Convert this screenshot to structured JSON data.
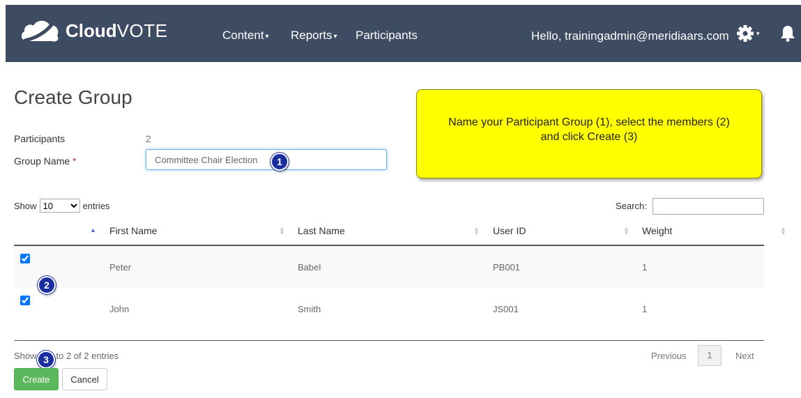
{
  "header": {
    "brand_bold": "Cloud",
    "brand_light": "VOTE",
    "nav": [
      {
        "label": "Content",
        "has_caret": true
      },
      {
        "label": "Reports",
        "has_caret": true
      },
      {
        "label": "Participants",
        "has_caret": false
      }
    ],
    "greeting": "Hello, trainingadmin@meridiaars.com",
    "icons": [
      "cloud-logo-icon",
      "gear-icon",
      "bell-icon"
    ],
    "bg_color": "#3d4b63"
  },
  "page": {
    "title": "Create Group",
    "participants_label": "Participants",
    "participants_count": "2",
    "group_name_label": "Group Name",
    "required_mark": "*",
    "group_name_value": "Committee Chair Election"
  },
  "callout": {
    "line1": "Name your Participant Group (1), select the members (2)",
    "line2": "and click Create (3)",
    "color": "#ffff00"
  },
  "badges": {
    "one": "1",
    "two": "2",
    "three": "3"
  },
  "table_controls": {
    "show_label": "Show",
    "entries_value": "10",
    "entries_label": "entries",
    "search_label": "Search:"
  },
  "table": {
    "columns": [
      "First Name",
      "Last Name",
      "User ID",
      "Weight"
    ],
    "rows": [
      {
        "checked": true,
        "first": "Peter",
        "last": "Babel",
        "user_id": "PB001",
        "weight": "1"
      },
      {
        "checked": true,
        "first": "John",
        "last": "Smith",
        "user_id": "JS001",
        "weight": "1"
      }
    ]
  },
  "footer": {
    "info_prefix": "Show",
    "info_suffix": "to 2 of 2 entries",
    "prev_label": "Previous",
    "page_label": "1",
    "next_label": "Next",
    "create_label": "Create",
    "cancel_label": "Cancel",
    "create_color": "#5cb85c"
  }
}
